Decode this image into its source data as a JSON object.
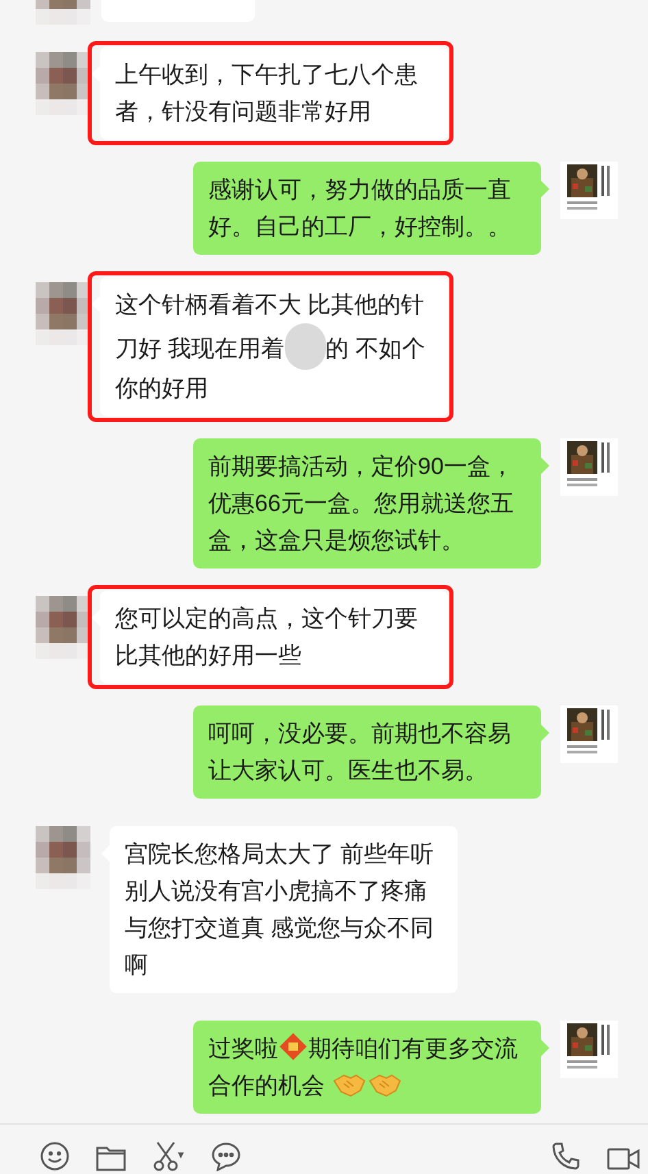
{
  "messages": [
    {
      "kind": "cutoff",
      "highlighted": false
    },
    {
      "kind": "received",
      "highlighted": true,
      "segments": [
        {
          "kind": "text",
          "text": "上午收到，下午扎了七八个患者，针没有问题非常好用"
        }
      ]
    },
    {
      "kind": "sent",
      "highlighted": false,
      "segments": [
        {
          "kind": "text",
          "text": "感谢认可，努力做的品质一直好。自己的工厂，好控制。。"
        }
      ]
    },
    {
      "kind": "received",
      "highlighted": true,
      "segments": [
        {
          "kind": "text",
          "text": "这个针柄看着不大 比其他的针刀好 我现在用着"
        },
        {
          "kind": "blur"
        },
        {
          "kind": "text",
          "text": "的 不如个你的好用"
        }
      ]
    },
    {
      "kind": "sent",
      "highlighted": false,
      "segments": [
        {
          "kind": "text",
          "text": "前期要搞活动，定价90一盒，优惠66元一盒。您用就送您五盒，这盒只是烦您试针。"
        }
      ]
    },
    {
      "kind": "received",
      "highlighted": true,
      "segments": [
        {
          "kind": "text",
          "text": "您可以定的高点，这个针刀要比其他的好用一些"
        }
      ]
    },
    {
      "kind": "sent",
      "highlighted": false,
      "segments": [
        {
          "kind": "text",
          "text": "呵呵，没必要。前期也不容易让大家认可。医生也不易。"
        }
      ]
    },
    {
      "kind": "received",
      "highlighted": false,
      "segments": [
        {
          "kind": "text",
          "text": "宫院长您格局太大了 前些年听别人说没有宫小虎搞不了疼痛与您打交道真 感觉您与众不同啊"
        }
      ]
    },
    {
      "kind": "sent",
      "highlighted": false,
      "segments": [
        {
          "kind": "text",
          "text": "过奖啦"
        },
        {
          "kind": "fu"
        },
        {
          "kind": "text",
          "text": "期待咱们有更多交流合作的机会 "
        },
        {
          "kind": "handshake"
        },
        {
          "kind": "handshake"
        }
      ]
    }
  ],
  "toolbar": [
    {
      "kind": "emoji"
    },
    {
      "kind": "folder"
    },
    {
      "kind": "scissors"
    },
    {
      "kind": "chat"
    }
  ],
  "call_buttons": [
    {
      "kind": "phone"
    },
    {
      "kind": "video"
    }
  ]
}
